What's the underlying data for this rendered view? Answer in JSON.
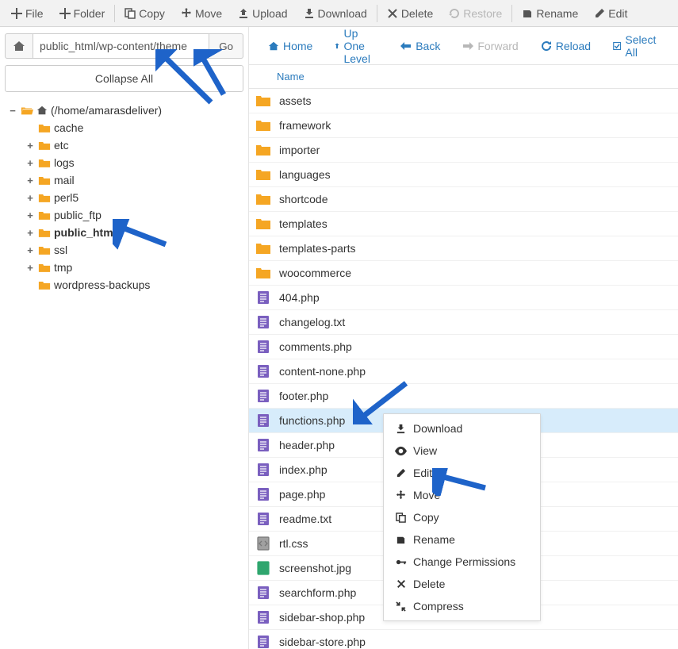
{
  "toolbar": {
    "file": "File",
    "folder": "Folder",
    "copy": "Copy",
    "move": "Move",
    "upload": "Upload",
    "download": "Download",
    "delete": "Delete",
    "restore": "Restore",
    "rename": "Rename",
    "edit": "Edit"
  },
  "path": {
    "value": "public_html/wp-content/theme",
    "go": "Go"
  },
  "collapse_all": "Collapse All",
  "tree": {
    "root_label": "(/home/amarasdeliver)",
    "children": [
      {
        "label": "cache",
        "expandable": false
      },
      {
        "label": "etc",
        "expandable": true
      },
      {
        "label": "logs",
        "expandable": true
      },
      {
        "label": "mail",
        "expandable": true
      },
      {
        "label": "perl5",
        "expandable": true
      },
      {
        "label": "public_ftp",
        "expandable": true
      },
      {
        "label": "public_html",
        "expandable": true,
        "bold": true
      },
      {
        "label": "ssl",
        "expandable": true
      },
      {
        "label": "tmp",
        "expandable": true
      },
      {
        "label": "wordpress-backups",
        "expandable": false
      }
    ]
  },
  "nav": {
    "home": "Home",
    "up": "Up One Level",
    "back": "Back",
    "forward": "Forward",
    "reload": "Reload",
    "select_all": "Select All"
  },
  "list": {
    "column_name": "Name",
    "items": [
      {
        "name": "assets",
        "kind": "folder"
      },
      {
        "name": "framework",
        "kind": "folder"
      },
      {
        "name": "importer",
        "kind": "folder"
      },
      {
        "name": "languages",
        "kind": "folder"
      },
      {
        "name": "shortcode",
        "kind": "folder"
      },
      {
        "name": "templates",
        "kind": "folder"
      },
      {
        "name": "templates-parts",
        "kind": "folder"
      },
      {
        "name": "woocommerce",
        "kind": "folder"
      },
      {
        "name": "404.php",
        "kind": "php"
      },
      {
        "name": "changelog.txt",
        "kind": "php"
      },
      {
        "name": "comments.php",
        "kind": "php"
      },
      {
        "name": "content-none.php",
        "kind": "php"
      },
      {
        "name": "footer.php",
        "kind": "php"
      },
      {
        "name": "functions.php",
        "kind": "php",
        "selected": true
      },
      {
        "name": "header.php",
        "kind": "php"
      },
      {
        "name": "index.php",
        "kind": "php"
      },
      {
        "name": "page.php",
        "kind": "php"
      },
      {
        "name": "readme.txt",
        "kind": "php"
      },
      {
        "name": "rtl.css",
        "kind": "code"
      },
      {
        "name": "screenshot.jpg",
        "kind": "image"
      },
      {
        "name": "searchform.php",
        "kind": "php"
      },
      {
        "name": "sidebar-shop.php",
        "kind": "php"
      },
      {
        "name": "sidebar-store.php",
        "kind": "php"
      }
    ]
  },
  "context_menu": {
    "download": "Download",
    "view": "View",
    "edit": "Edit",
    "move": "Move",
    "copy": "Copy",
    "rename": "Rename",
    "permissions": "Change Permissions",
    "delete": "Delete",
    "compress": "Compress"
  }
}
